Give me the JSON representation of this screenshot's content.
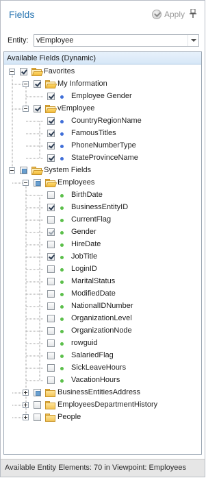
{
  "header": {
    "title": "Fields",
    "apply_label": "Apply"
  },
  "entity": {
    "label": "Entity:",
    "value": "vEmployee"
  },
  "tree": {
    "heading": "Available Fields (Dynamic)",
    "nodes": [
      {
        "label": "Favorites",
        "kind": "folder-open",
        "check": "checked"
      },
      {
        "label": "My Information",
        "kind": "folder-open",
        "check": "checked"
      },
      {
        "label": "Employee Gender",
        "kind": "field-blue",
        "check": "checked"
      },
      {
        "label": "vEmployee",
        "kind": "folder-open",
        "check": "checked"
      },
      {
        "label": "CountryRegionName",
        "kind": "field-blue",
        "check": "checked"
      },
      {
        "label": "FamousTitles",
        "kind": "field-blue",
        "check": "checked"
      },
      {
        "label": "PhoneNumberType",
        "kind": "field-blue",
        "check": "checked"
      },
      {
        "label": "StateProvinceName",
        "kind": "field-blue",
        "check": "checked"
      },
      {
        "label": "System Fields",
        "kind": "folder-open",
        "check": "partial"
      },
      {
        "label": "Employees",
        "kind": "folder-open",
        "check": "partial"
      },
      {
        "label": "BirthDate",
        "kind": "field-green",
        "check": "unchecked"
      },
      {
        "label": "BusinessEntityID",
        "kind": "field-green",
        "check": "checked"
      },
      {
        "label": "CurrentFlag",
        "kind": "field-green",
        "check": "unchecked"
      },
      {
        "label": "Gender",
        "kind": "field-green",
        "check": "checked-dim"
      },
      {
        "label": "HireDate",
        "kind": "field-green",
        "check": "unchecked"
      },
      {
        "label": "JobTitle",
        "kind": "field-green",
        "check": "checked"
      },
      {
        "label": "LoginID",
        "kind": "field-green",
        "check": "unchecked"
      },
      {
        "label": "MaritalStatus",
        "kind": "field-green",
        "check": "unchecked"
      },
      {
        "label": "ModifiedDate",
        "kind": "field-green",
        "check": "unchecked"
      },
      {
        "label": "NationalIDNumber",
        "kind": "field-green",
        "check": "unchecked"
      },
      {
        "label": "OrganizationLevel",
        "kind": "field-green",
        "check": "unchecked"
      },
      {
        "label": "OrganizationNode",
        "kind": "field-green",
        "check": "unchecked"
      },
      {
        "label": "rowguid",
        "kind": "field-green",
        "check": "unchecked"
      },
      {
        "label": "SalariedFlag",
        "kind": "field-green",
        "check": "unchecked"
      },
      {
        "label": "SickLeaveHours",
        "kind": "field-green",
        "check": "unchecked"
      },
      {
        "label": "VacationHours",
        "kind": "field-green",
        "check": "unchecked"
      },
      {
        "label": "BusinessEntitiesAddress",
        "kind": "folder-closed",
        "check": "partial"
      },
      {
        "label": "EmployeesDepartmentHistory",
        "kind": "folder-closed",
        "check": "unchecked"
      },
      {
        "label": "People",
        "kind": "folder-closed",
        "check": "unchecked"
      }
    ]
  },
  "status": {
    "text": "Available Entity Elements: 70 in Viewpoint: Employees"
  }
}
